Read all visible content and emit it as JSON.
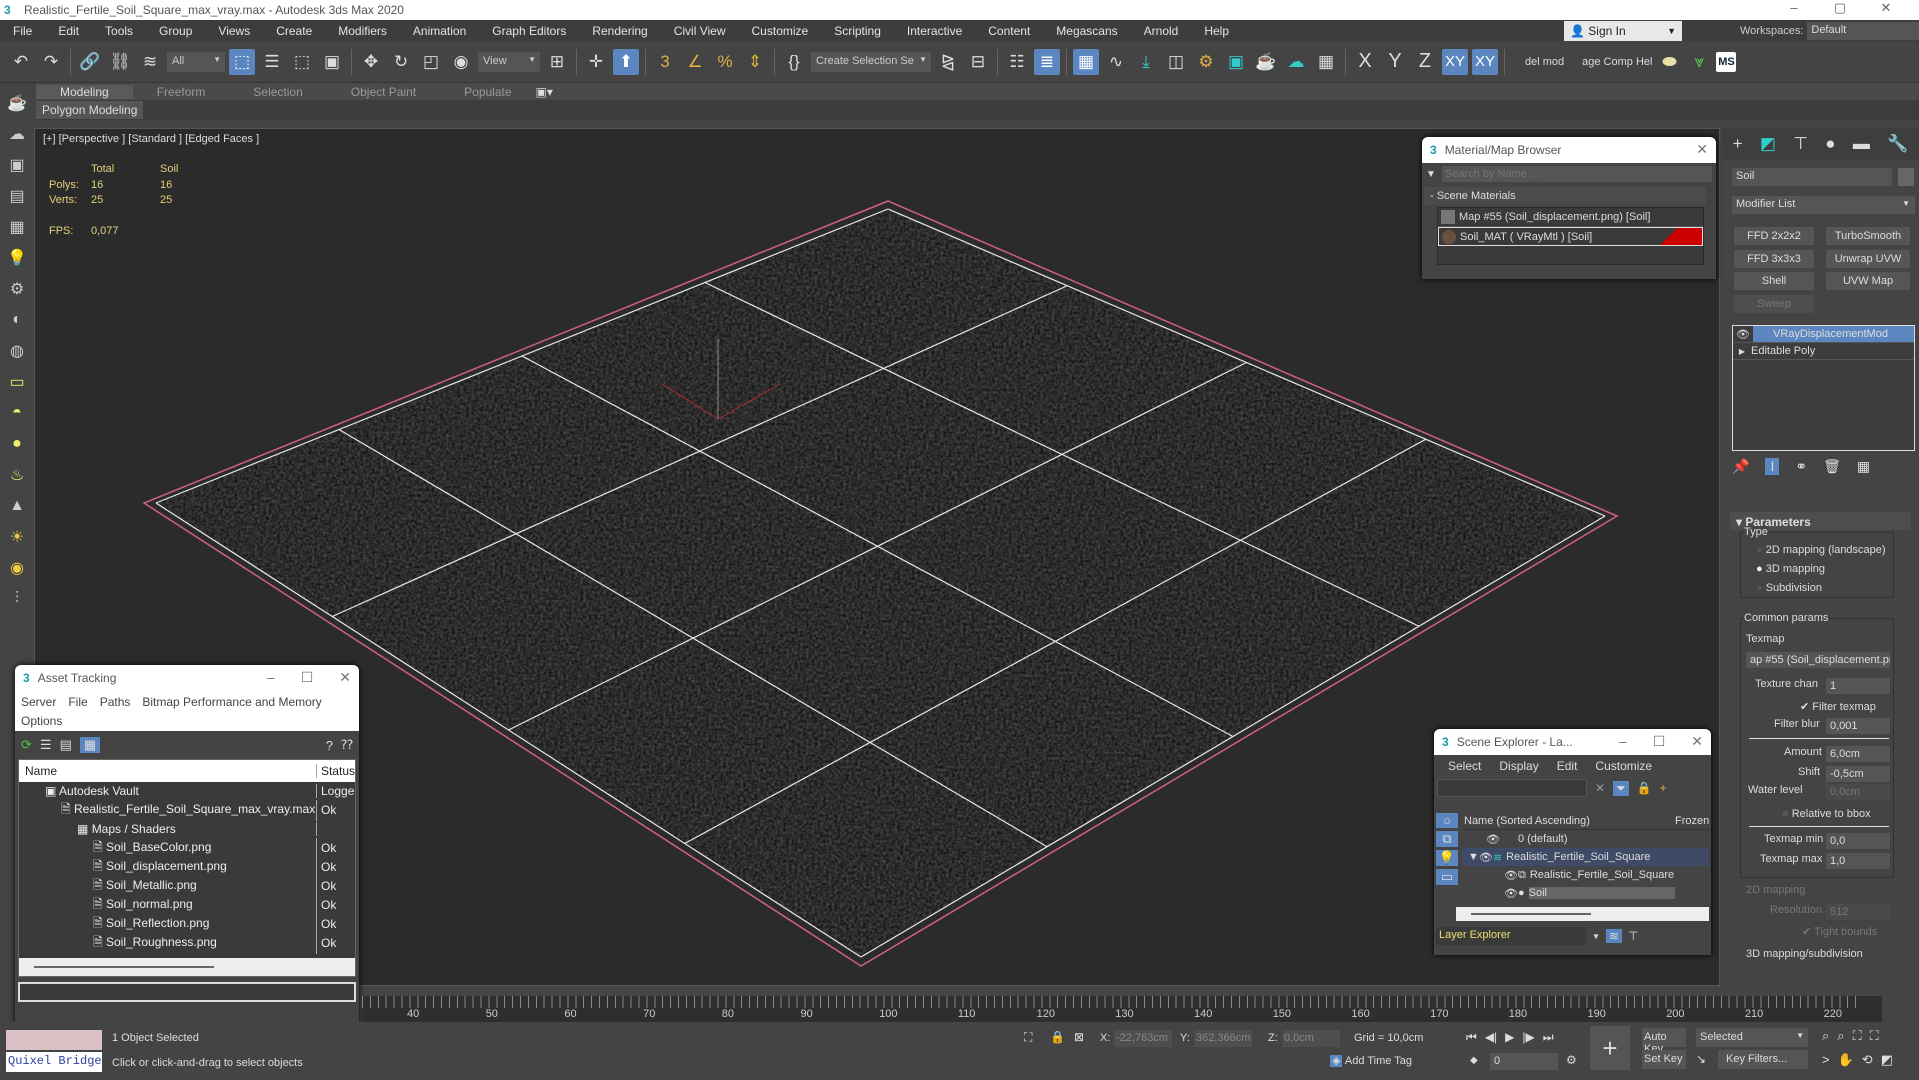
{
  "window": {
    "title": "Realistic_Fertile_Soil_Square_max_vray.max - Autodesk 3ds Max 2020",
    "controls": [
      "–",
      "▢",
      "✕"
    ]
  },
  "menu": [
    "File",
    "Edit",
    "Tools",
    "Group",
    "Views",
    "Create",
    "Modifiers",
    "Animation",
    "Graph Editors",
    "Rendering",
    "Civil View",
    "Customize",
    "Scripting",
    "Interactive",
    "Content",
    "Megascans",
    "Arnold",
    "Help"
  ],
  "signin": "Sign In",
  "workspaces": {
    "label": "Workspaces:",
    "value": "Default"
  },
  "toolbar": {
    "filter": "All",
    "refcoord": "View",
    "selset": "Create Selection Se",
    "axes": [
      "X",
      "Y",
      "Z",
      "XY",
      "XY"
    ],
    "script1": "del mod",
    "script2": "age Comp Hel",
    "ms": "MS"
  },
  "ribbon": {
    "tabs": [
      "Modeling",
      "Freeform",
      "Selection",
      "Object Paint",
      "Populate"
    ],
    "sub": "Polygon Modeling"
  },
  "viewport": {
    "label": "[+] [Perspective ] [Standard ] [Edged Faces ]",
    "stats": {
      "h_total": "Total",
      "h_obj": "Soil",
      "polys_label": "Polys:",
      "polys_total": "16",
      "polys_obj": "16",
      "verts_label": "Verts:",
      "verts_total": "25",
      "verts_obj": "25",
      "fps_label": "FPS:",
      "fps": "0,077"
    }
  },
  "material_browser": {
    "title": "Material/Map Browser",
    "search_placeholder": "Search by Name ...",
    "group": "- Scene Materials",
    "items": [
      "Map #55 (Soil_displacement.png) [Soil]",
      "Soil_MAT  ( VRayMtl )  [Soil]"
    ]
  },
  "command_panel": {
    "object_name": "Soil",
    "modifier_list": "Modifier List",
    "buttons": [
      "FFD 2x2x2",
      "TurboSmooth",
      "FFD 3x3x3",
      "Unwrap UVW",
      "Shell",
      "UVW Map",
      "Sweep"
    ],
    "stack": [
      "VRayDisplacementMod",
      "Editable Poly"
    ],
    "params": {
      "title": "Parameters",
      "type_label": "Type",
      "types": [
        "2D mapping (landscape)",
        "3D mapping",
        "Subdivision"
      ],
      "selected_type": 1,
      "common": "Common params",
      "texmap_label": "Texmap",
      "texmap": "ap #55 (Soil_displacement.pn",
      "texture_chan_label": "Texture chan",
      "texture_chan": "1",
      "filter_texmap": "Filter texmap",
      "filter_blur_label": "Filter blur",
      "filter_blur": "0,001",
      "amount_label": "Amount",
      "amount": "6,0cm",
      "shift_label": "Shift",
      "shift": "-0,5cm",
      "water_label": "Water level",
      "water": "0,0cm",
      "relative": "Relative to bbox",
      "tmin_label": "Texmap min",
      "tmin": "0,0",
      "tmax_label": "Texmap max",
      "tmax": "1,0",
      "map2d": "2D mapping",
      "res_label": "Resolution",
      "res": "512",
      "tight": "Tight bounds",
      "map3d": "3D mapping/subdivision"
    }
  },
  "asset_tracking": {
    "title": "Asset Tracking",
    "menu": [
      "Server",
      "File",
      "Paths",
      "Bitmap Performance and Memory",
      "Options"
    ],
    "col_name": "Name",
    "col_status": "Status",
    "rows": [
      {
        "name": "Autodesk Vault",
        "status": "Logge",
        "indent": 0
      },
      {
        "name": "Realistic_Fertile_Soil_Square_max_vray.max",
        "status": "Ok",
        "indent": 1
      },
      {
        "name": "Maps / Shaders",
        "status": "",
        "indent": 2
      },
      {
        "name": "Soil_BaseColor.png",
        "status": "Ok",
        "indent": 3
      },
      {
        "name": "Soil_displacement.png",
        "status": "Ok",
        "indent": 3
      },
      {
        "name": "Soil_Metallic.png",
        "status": "Ok",
        "indent": 3
      },
      {
        "name": "Soil_normal.png",
        "status": "Ok",
        "indent": 3
      },
      {
        "name": "Soil_Reflection.png",
        "status": "Ok",
        "indent": 3
      },
      {
        "name": "Soil_Roughness.png",
        "status": "Ok",
        "indent": 3
      }
    ]
  },
  "scene_explorer": {
    "title": "Scene Explorer - La...",
    "menu": [
      "Select",
      "Display",
      "Edit",
      "Customize"
    ],
    "col_name": "Name (Sorted Ascending)",
    "col_frozen": "Frozen",
    "rows": [
      "0 (default)",
      "Realistic_Fertile_Soil_Square",
      "Realistic_Fertile_Soil_Square",
      "Soil"
    ],
    "footer": "Layer Explorer"
  },
  "timeline": {
    "ticks": [
      "40",
      "50",
      "60",
      "70",
      "80",
      "90",
      "100",
      "110",
      "120",
      "130",
      "140",
      "150",
      "160",
      "170",
      "180",
      "190",
      "200",
      "210",
      "220"
    ]
  },
  "status": {
    "quixel": "Quixel Bridge",
    "selected": "1 Object Selected",
    "prompt": "Click or click-and-drag to select objects",
    "x_label": "X:",
    "x": "-22,763cm",
    "y_label": "Y:",
    "y": "362,366cm",
    "z_label": "Z:",
    "z": "0,0cm",
    "grid": "Grid = 10,0cm",
    "add_time_tag": "Add Time Tag",
    "frame": "0",
    "auto_key": "Auto Key",
    "set_key": "Set Key",
    "key_mode": "Selected",
    "key_filters": "Key Filters..."
  }
}
